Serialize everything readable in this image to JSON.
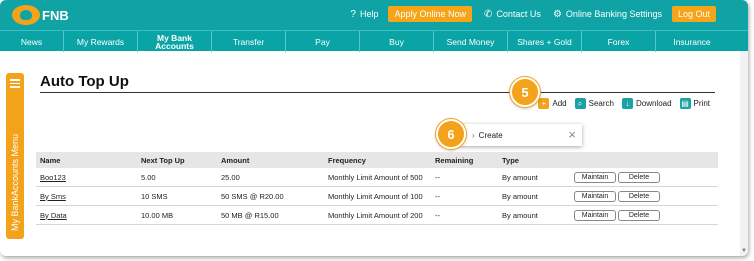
{
  "brand": {
    "name": "FNB"
  },
  "top_links": {
    "help": "Help",
    "apply_online": "Apply Online Now",
    "contact_us": "Contact Us",
    "settings": "Online Banking Settings",
    "log_out": "Log Out"
  },
  "nav": {
    "items": [
      {
        "label": "News"
      },
      {
        "label": "My Rewards"
      },
      {
        "label": "My Bank Accounts"
      },
      {
        "label": "Transfer"
      },
      {
        "label": "Pay"
      },
      {
        "label": "Buy"
      },
      {
        "label": "Send Money"
      },
      {
        "label": "Shares + Gold"
      },
      {
        "label": "Forex"
      },
      {
        "label": "Insurance"
      }
    ]
  },
  "side_menu": {
    "label": "My BankAccounts Menu"
  },
  "page": {
    "title": "Auto Top Up"
  },
  "toolbar": {
    "add": "Add",
    "search": "Search",
    "download": "Download",
    "print": "Print"
  },
  "steps": {
    "step5": "5",
    "step6": "6"
  },
  "popup": {
    "create": "Create",
    "close": "×"
  },
  "table": {
    "headers": [
      "Name",
      "Next Top Up",
      "Amount",
      "Frequency",
      "Remaining",
      "Type"
    ],
    "rows": [
      {
        "name": "Boo123",
        "next": "5.00",
        "amount": "25.00",
        "frequency": "Monthly Limit Amount of 500",
        "remaining": "--",
        "type": "By amount"
      },
      {
        "name": "By Sms",
        "next": "10 SMS",
        "amount": "50 SMS @ R20.00",
        "frequency": "Monthly Limit Amount of 100",
        "remaining": "--",
        "type": "By amount"
      },
      {
        "name": "By Data",
        "next": "10.00 MB",
        "amount": "50 MB @ R15.00",
        "frequency": "Monthly Limit Amount of 200",
        "remaining": "--",
        "type": "By amount"
      }
    ],
    "maintain": "Maintain",
    "delete": "Delete"
  },
  "colors": {
    "teal": "#0fa3a5",
    "orange": "#f3a21b"
  },
  "icons": {
    "help": "help-icon",
    "contact": "phone-icon",
    "settings": "gear-icon",
    "add": "plus-icon",
    "search": "search-icon",
    "download": "download-icon",
    "print": "print-icon",
    "menu": "hamburger-icon"
  }
}
